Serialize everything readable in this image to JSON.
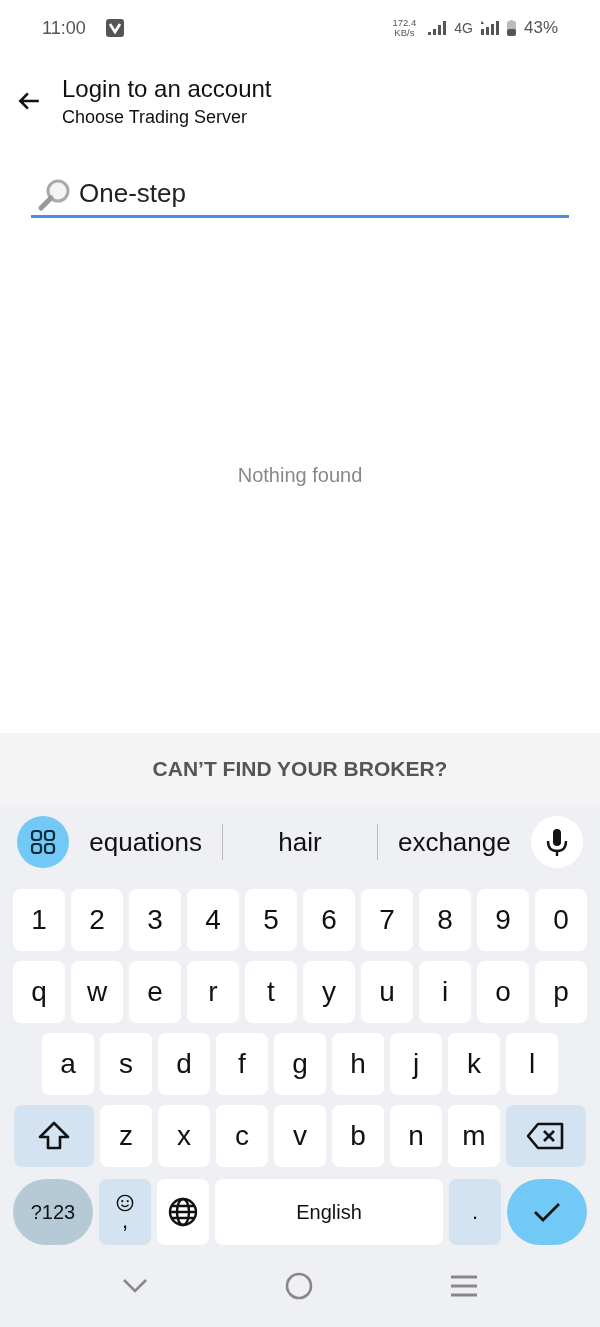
{
  "status_bar": {
    "time": "11:00",
    "speed_value": "172.4",
    "speed_unit": "KB/s",
    "network": "4G",
    "battery": "43%"
  },
  "header": {
    "title": "Login to an account",
    "subtitle": "Choose Trading Server"
  },
  "search": {
    "value": "One-step"
  },
  "empty_message": "Nothing found",
  "broker_button": "CAN’T FIND YOUR BROKER?",
  "suggestions": [
    "equations",
    "hair",
    "exchange"
  ],
  "keyboard": {
    "digits": [
      "1",
      "2",
      "3",
      "4",
      "5",
      "6",
      "7",
      "8",
      "9",
      "0"
    ],
    "row_1": [
      "q",
      "w",
      "e",
      "r",
      "t",
      "y",
      "u",
      "i",
      "o",
      "p"
    ],
    "row_2": [
      "a",
      "s",
      "d",
      "f",
      "g",
      "h",
      "j",
      "k",
      "l"
    ],
    "row_3": [
      "z",
      "x",
      "c",
      "v",
      "b",
      "n",
      "m"
    ],
    "symbols_key": "?123",
    "comma_key": ",",
    "space_key": "English",
    "period_key": "."
  }
}
